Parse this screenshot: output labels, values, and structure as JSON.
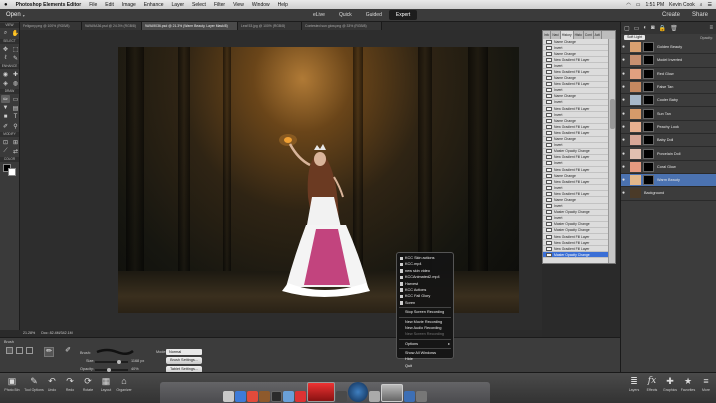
{
  "menubar": {
    "apple": "",
    "app_name": "Photoshop Elements Editor",
    "items": [
      "File",
      "Edit",
      "Image",
      "Enhance",
      "Layer",
      "Select",
      "Filter",
      "View",
      "Window",
      "Help"
    ],
    "time": "1:51 PM",
    "user": "Kevin Cook"
  },
  "modebar": {
    "open_label": "Open",
    "modes": [
      "eLive",
      "Quick",
      "Guided",
      "Expert"
    ],
    "active_mode": "Expert",
    "create_label": "Create",
    "share_label": "Share"
  },
  "tabs": [
    "Feligony.png @ 100% (RGB/8)",
    "9A9A9A36.psd @ 24.3% (RGB/8)",
    "9A9A9036.psd @ 21.3% (Warm Beauty, Layer Mask/8)",
    "Leaf 53.jpg @ 100% (RGB/8)",
    "Contested sun glow.png @ 33% (RGB/8)"
  ],
  "toolbar": {
    "sections": [
      "VIEW",
      "SELECT",
      "ENHANCE",
      "DRAW",
      "MODIFY",
      "COLOR"
    ],
    "tools": [
      {
        "name": "zoom-tool",
        "glyph": "⌕"
      },
      {
        "name": "hand-tool",
        "glyph": "✋"
      },
      {
        "name": "move-tool",
        "glyph": "✥"
      },
      {
        "name": "marquee-tool",
        "glyph": "⬚"
      },
      {
        "name": "lasso-tool",
        "glyph": "ℓ"
      },
      {
        "name": "quick-select-tool",
        "glyph": "✎"
      },
      {
        "name": "eye-tool",
        "glyph": "◉"
      },
      {
        "name": "spot-heal-tool",
        "glyph": "✚"
      },
      {
        "name": "clone-tool",
        "glyph": "◈"
      },
      {
        "name": "sponge-tool",
        "glyph": "◍"
      },
      {
        "name": "brush-tool",
        "glyph": "✏"
      },
      {
        "name": "eraser-tool",
        "glyph": "▭"
      },
      {
        "name": "paint-bucket-tool",
        "glyph": "▼"
      },
      {
        "name": "gradient-tool",
        "glyph": "▤"
      },
      {
        "name": "shape-tool",
        "glyph": "■"
      },
      {
        "name": "type-tool",
        "glyph": "T"
      },
      {
        "name": "pencil-tool",
        "glyph": "✐"
      },
      {
        "name": "dropper-tool",
        "glyph": "⚲"
      },
      {
        "name": "crop-tool",
        "glyph": "⊡"
      },
      {
        "name": "recompose-tool",
        "glyph": "⊞"
      },
      {
        "name": "straighten-tool",
        "glyph": "⟋"
      },
      {
        "name": "content-move-tool",
        "glyph": "⇄"
      }
    ]
  },
  "statusbar": {
    "zoom": "21.28%",
    "doc": "Doc: 82.4M/342.1M"
  },
  "tool_options": {
    "section_label": "Brush",
    "brush_label": "Brush:",
    "size_label": "Size:",
    "size_value": "1168 px",
    "opacity_label": "Opacity:",
    "opacity_value": "40%",
    "size_level": 0.75,
    "opacity_level": 0.4,
    "mode_label": "Mode:",
    "mode_value": "Normal",
    "brush_settings": "Brush Settings...",
    "tablet_settings": "Tablet Settings..."
  },
  "bottombar": {
    "left": [
      {
        "name": "photo-bin",
        "label": "Photo Bin",
        "glyph": "▣"
      },
      {
        "name": "tool-options",
        "label": "Tool Options",
        "glyph": "✎"
      },
      {
        "name": "undo",
        "label": "Undo",
        "glyph": "↶"
      },
      {
        "name": "redo",
        "label": "Redo",
        "glyph": "↷"
      },
      {
        "name": "rotate",
        "label": "Rotate",
        "glyph": "⟳"
      },
      {
        "name": "layout",
        "label": "Layout",
        "glyph": "▦"
      },
      {
        "name": "organizer",
        "label": "Organizer",
        "glyph": "⌂"
      }
    ],
    "right": [
      {
        "name": "layers",
        "label": "Layers",
        "glyph": "≣"
      },
      {
        "name": "effects",
        "label": "Effects",
        "glyph": "fx"
      },
      {
        "name": "graphics",
        "label": "Graphics",
        "glyph": "✚"
      },
      {
        "name": "favorites",
        "label": "Favorites",
        "glyph": "★"
      },
      {
        "name": "more",
        "label": "More",
        "glyph": "≡"
      }
    ]
  },
  "history": {
    "tabs": [
      "Info",
      "Navi",
      "History",
      "Histo",
      "Cont",
      "Acti"
    ],
    "active_tab": "History",
    "items": [
      "Name Change",
      "Invert",
      "Name Change",
      "New Gradient Fill Layer",
      "Invert",
      "New Gradient Fill Layer",
      "Name Change",
      "New Gradient Fill Layer",
      "Invert",
      "Name Change",
      "Invert",
      "New Gradient Fill Layer",
      "Invert",
      "Name Change",
      "New Gradient Fill Layer",
      "New Gradient Fill Layer",
      "Name Change",
      "Invert",
      "Master Opacity Change",
      "New Gradient Fill Layer",
      "Invert",
      "New Gradient Fill Layer",
      "Name Change",
      "New Gradient Fill Layer",
      "Invert",
      "New Gradient Fill Layer",
      "Name Change",
      "Invert",
      "Master Opacity Change",
      "Invert",
      "Master Opacity Change",
      "Master Opacity Change",
      "New Gradient Fill Layer",
      "New Gradient Fill Layer",
      "New Gradient Fill Layer",
      "Master Opacity Change"
    ],
    "selected_index": 35
  },
  "layers": {
    "blend_mode": "Soft Light",
    "opacity_label": "Opacity:",
    "items": [
      {
        "name": "Golden Beauty",
        "thumb": "#d9a070"
      },
      {
        "name": "Model Inverted",
        "thumb": "#c89070"
      },
      {
        "name": "Red Glow",
        "thumb": "#e0a080"
      },
      {
        "name": "False Tan",
        "thumb": "#c58860"
      },
      {
        "name": "Cooler Baby",
        "thumb": "#a8b8c8"
      },
      {
        "name": "Sun Tan",
        "thumb": "#d59a6a"
      },
      {
        "name": "Peachy Look",
        "thumb": "#e8b090"
      },
      {
        "name": "Baby Doll",
        "thumb": "#d8a898"
      },
      {
        "name": "Porcelain Doll",
        "thumb": "#e0c0b0"
      },
      {
        "name": "Coral Glow",
        "thumb": "#e59a80"
      },
      {
        "name": "Warm Beauty",
        "thumb": "#e3b78a"
      },
      {
        "name": "Background",
        "thumb": "#4a3a28"
      }
    ],
    "selected": "Warm Beauty"
  },
  "context_menu": {
    "files": [
      "KCC Skin actions",
      "KCC.mp4",
      "new skin video",
      "KCCAnimated2.mp4",
      "Harvest",
      "KCC Actions",
      "KCC Fall Glory",
      "Soren"
    ],
    "recording": [
      "Stop Screen Recording"
    ],
    "new_items": [
      "New Movie Recording",
      "New Audio Recording",
      "New Screen Recording"
    ],
    "options_label": "Options",
    "window_items": [
      "Show All Windows",
      "Hide",
      "Quit"
    ]
  }
}
